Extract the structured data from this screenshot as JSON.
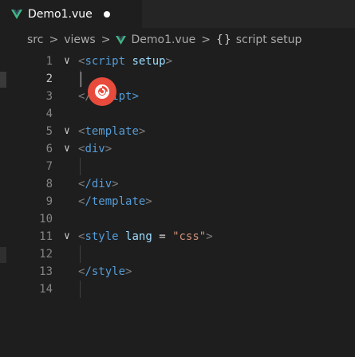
{
  "tab": {
    "label": "Demo1.vue",
    "icon": "vue-logo-icon",
    "modified": true
  },
  "breadcrumb": {
    "items": [
      "src",
      "views",
      "Demo1.vue",
      "script setup"
    ],
    "separator": ">",
    "braces": "{}"
  },
  "lines": [
    {
      "num": "1"
    },
    {
      "num": "2"
    },
    {
      "num": "3"
    },
    {
      "num": "4"
    },
    {
      "num": "5"
    },
    {
      "num": "6"
    },
    {
      "num": "7"
    },
    {
      "num": "8"
    },
    {
      "num": "9"
    },
    {
      "num": "10"
    },
    {
      "num": "11"
    },
    {
      "num": "12"
    },
    {
      "num": "13"
    },
    {
      "num": "14"
    }
  ],
  "code": {
    "l1_tag": "script",
    "l1_attr": "setup",
    "l3_partial": "ipt>",
    "l5_tag": "template",
    "l6_tag": "div",
    "l8_tag": "/div",
    "l9_tag": "/template",
    "l11_tag": "style",
    "l11_attr": "lang",
    "l11_eq": "=",
    "l11_val": "\"css\"",
    "l13_tag": "/style"
  },
  "colors": {
    "background": "#1e1e1e",
    "tag": "#569cd6",
    "attribute": "#9cdcfe",
    "string": "#ce9178",
    "overlay_badge": "#e84b3c"
  }
}
